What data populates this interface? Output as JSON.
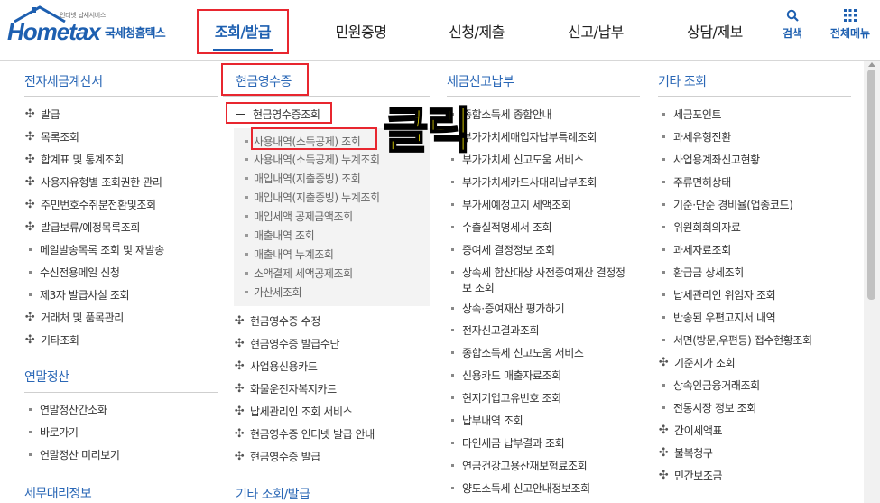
{
  "logo": {
    "tagline": "인터넷 납세서비스",
    "main": "Hometax",
    "sub": "국세청홈택스"
  },
  "nav": [
    "조회/발급",
    "민원증명",
    "신청/제출",
    "신고/납부",
    "상담/제보"
  ],
  "util": {
    "search": "검색",
    "all_menu": "전체메뉴"
  },
  "columns": {
    "c1": {
      "title": "전자세금계산서",
      "items": [
        "발급",
        "목록조회",
        "합계표 및 통계조회",
        "사용자유형별 조회권한 관리",
        "주민번호수취분전환및조회",
        "발급보류/예정목록조회",
        "메일발송목록 조회 및 재발송",
        "수신전용메일 신청",
        "제3자 발급사실 조회",
        "거래처 및 품목관리",
        "기타조회"
      ],
      "title2": "연말정산",
      "items2": [
        "연말정산간소화",
        "바로가기",
        "연말정산 미리보기"
      ],
      "title3": "세무대리정보"
    },
    "c2": {
      "title": "현금영수증",
      "open_item": "현금영수증조회",
      "sub_items": [
        "사용내역(소득공제) 조회",
        "사용내역(소득공제) 누계조회",
        "매입내역(지출증빙) 조회",
        "매입내역(지출증빙) 누계조회",
        "매입세액 공제금액조회",
        "매출내역 조회",
        "매출내역 누계조회",
        "소액결제 세액공제조회",
        "가산세조회"
      ],
      "items": [
        "현금영수증 수정",
        "현금영수증 발급수단",
        "사업용신용카드",
        "화물운전자복지카드",
        "납세관리인 조회 서비스",
        "현금영수증 인터넷 발급 안내",
        "현금영수증 발급"
      ],
      "title2": "기타 조회/발급"
    },
    "c3": {
      "title": "세금신고납부",
      "items": [
        "종합소득세 종합안내",
        "부가가치세매입자납부특례조회",
        "부가가치세 신고도움 서비스",
        "부가가치세카드사대리납부조회",
        "부가세예정고지 세액조회",
        "수출실적명세서 조회",
        "증여세 결정정보 조회",
        "상속세 합산대상 사전증여재산 결정정",
        "보 조회",
        "상속·증여재산 평가하기",
        "전자신고결과조회",
        "종합소득세 신고도움 서비스",
        "신용카드 매출자료조회",
        "현지기업고유번호 조회",
        "납부내역 조회",
        "타인세금 납부결과 조회",
        "연금건강고용산재보험료조회",
        "양도소득세 신고안내정보조회"
      ]
    },
    "c4": {
      "title": "기타 조회",
      "items": [
        "세금포인트",
        "과세유형전환",
        "사업용계좌신고현황",
        "주류면허상태",
        "기준·단순 경비율(업종코드)",
        "위원회회의자료",
        "과세자료조회",
        "환급금 상세조회",
        "납세관리인 위임자 조회",
        "반송된 우편고지서 내역",
        "서면(방문,우편등) 접수현황조회",
        "기준시가 조회",
        "상속인금융거래조회",
        "전통시장 정보 조회",
        "간이세액표",
        "불복청구",
        "민간보조금"
      ]
    }
  },
  "annotation": "클릭",
  "colors": {
    "brand": "#1d5fb0",
    "title": "#2a67b6",
    "highlight": "#e8262f",
    "annotation": "#ffef00"
  }
}
